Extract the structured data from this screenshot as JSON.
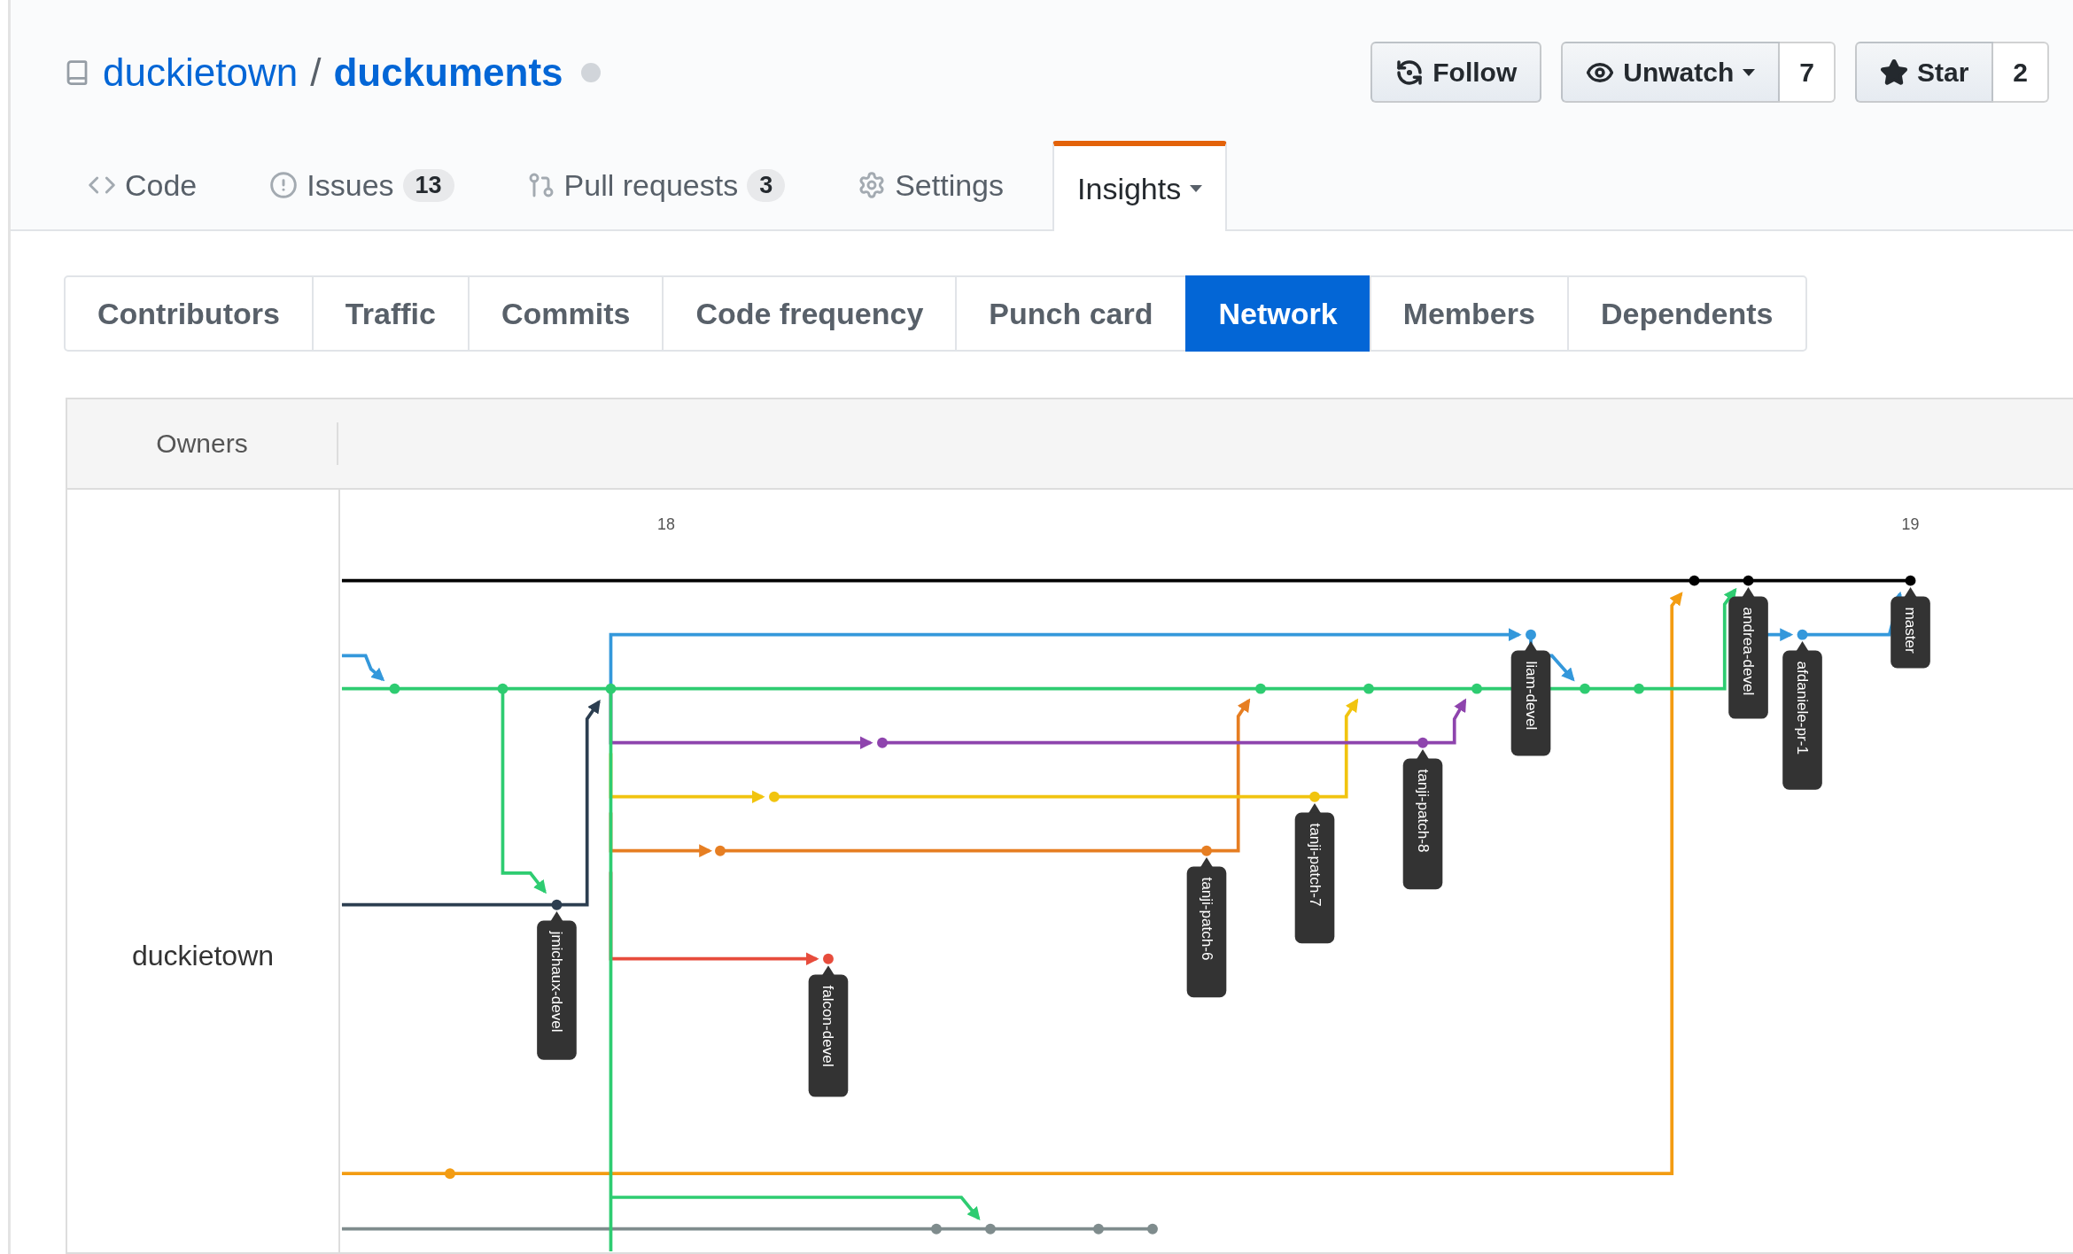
{
  "repo": {
    "owner": "duckietown",
    "separator": "/",
    "name": "duckuments"
  },
  "actions": [
    {
      "kind": "follow",
      "label": "Follow"
    },
    {
      "kind": "watch",
      "label": "Unwatch",
      "count": "7"
    },
    {
      "kind": "star",
      "label": "Star",
      "count": "2"
    }
  ],
  "tabs": [
    {
      "kind": "code",
      "label": "Code",
      "selected": false
    },
    {
      "kind": "issues",
      "label": "Issues",
      "count": "13",
      "selected": false
    },
    {
      "kind": "pulls",
      "label": "Pull requests",
      "count": "3",
      "selected": false
    },
    {
      "kind": "settings",
      "label": "Settings",
      "selected": false
    },
    {
      "kind": "insights",
      "label": "Insights",
      "selected": true
    }
  ],
  "subnav": [
    {
      "label": "Contributors",
      "selected": false
    },
    {
      "label": "Traffic",
      "selected": false
    },
    {
      "label": "Commits",
      "selected": false
    },
    {
      "label": "Code frequency",
      "selected": false
    },
    {
      "label": "Punch card",
      "selected": false
    },
    {
      "label": "Network",
      "selected": true
    },
    {
      "label": "Members",
      "selected": false
    },
    {
      "label": "Dependents",
      "selected": false
    }
  ],
  "network": {
    "owners_heading": "Owners",
    "owner": "duckietown",
    "months": [
      "18",
      "19"
    ],
    "branches": [
      {
        "label": "jmichaux-devel",
        "color": "#2c3e50"
      },
      {
        "label": "falcon-devel",
        "color": "#e74c3c"
      },
      {
        "label": "tanji-patch-6",
        "color": "#e67e22"
      },
      {
        "label": "tanji-patch-7",
        "color": "#f1c40f"
      },
      {
        "label": "tanji-patch-8",
        "color": "#8e44ad"
      },
      {
        "label": "liam-devel",
        "color": "#3498db"
      },
      {
        "label": "andrea-devel",
        "color": "#2ecc71"
      },
      {
        "label": "afdaniele-pr-1",
        "color": "#3498db"
      },
      {
        "label": "master",
        "color": "#000000"
      }
    ]
  }
}
